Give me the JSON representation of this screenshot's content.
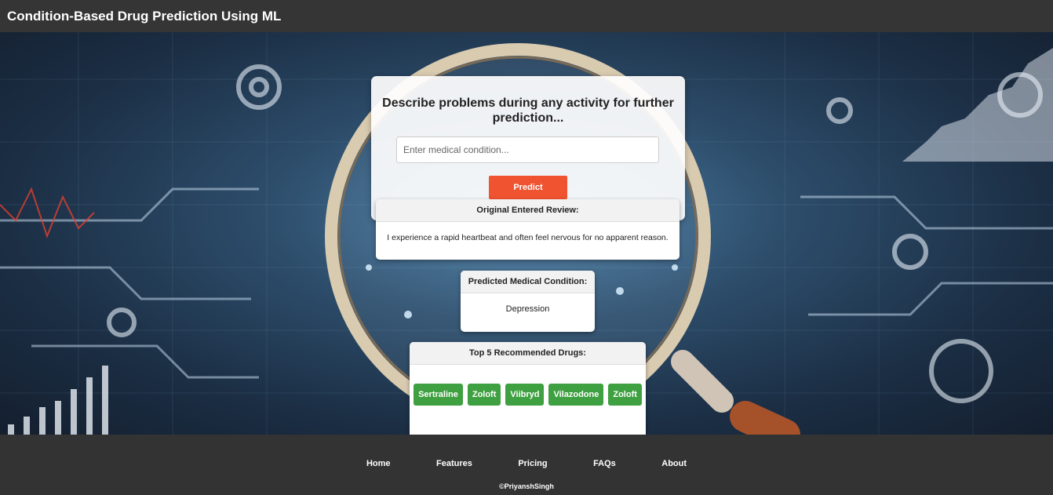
{
  "header": {
    "title": "Condition-Based Drug Prediction Using ML"
  },
  "form": {
    "heading": "Describe problems during any activity for further prediction...",
    "input_placeholder": "Enter medical condition...",
    "input_value": "",
    "predict_label": "Predict"
  },
  "review": {
    "title": "Original Entered Review:",
    "text": "I experience a rapid heartbeat and often feel nervous for no apparent reason."
  },
  "prediction": {
    "title": "Predicted Medical Condition:",
    "condition": "Depression"
  },
  "drugs": {
    "title": "Top 5 Recommended Drugs:",
    "items": [
      "Sertraline",
      "Zoloft",
      "Viibryd",
      "Vilazodone",
      "Zoloft"
    ]
  },
  "footer": {
    "links": [
      "Home",
      "Features",
      "Pricing",
      "FAQs",
      "About"
    ],
    "copyright": "©PriyanshSingh"
  },
  "colors": {
    "header_bg": "#353535",
    "predict_button": "#ef5330",
    "drug_chip": "#3ea040",
    "footer_bg": "#333333"
  }
}
